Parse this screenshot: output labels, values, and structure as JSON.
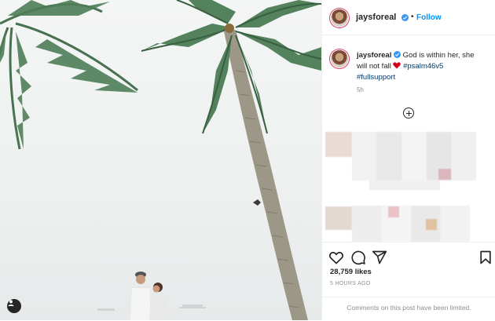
{
  "post": {
    "username": "jaysforeal",
    "separator": "•",
    "follow_label": "Follow",
    "caption_text": "God is within her, she will not fall",
    "hashtags": [
      "#psalm46v5",
      "#fullsupport"
    ],
    "caption_time": "5h",
    "likes": "28,759 likes",
    "posted_ago": "5 HOURS AGO",
    "comments_notice": "Comments on this post have been limited."
  },
  "icons": {
    "verified": "verified-badge-icon",
    "heart": "heart-icon",
    "caption_heart": "red-heart-emoji-icon",
    "comment": "comment-icon",
    "share": "share-icon",
    "save": "bookmark-icon",
    "tag": "user-tag-icon",
    "add": "plus-circle-icon"
  },
  "colors": {
    "accent": "#0095f6",
    "verified": "#3897f0",
    "hashtag": "#00376b",
    "muted": "#8e8e8e",
    "heart_red": "#d0021b"
  }
}
